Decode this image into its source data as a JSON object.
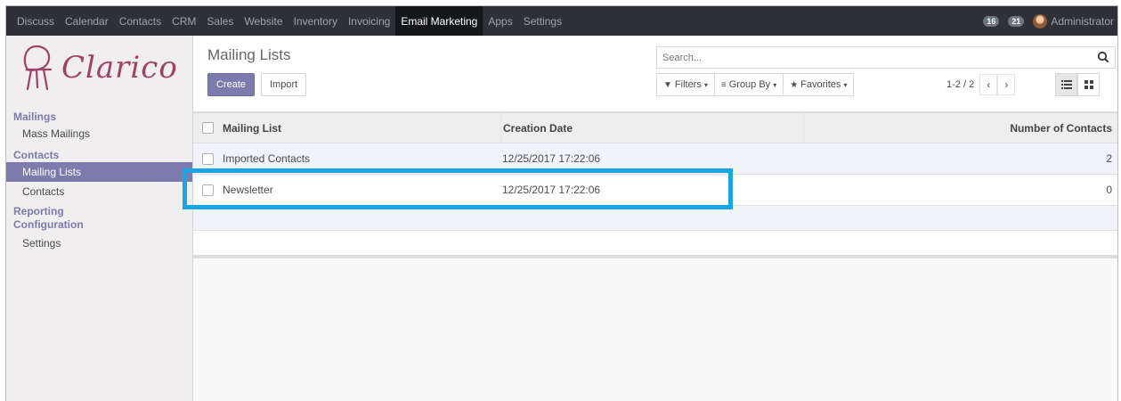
{
  "topbar": {
    "menu": [
      "Discuss",
      "Calendar",
      "Contacts",
      "CRM",
      "Sales",
      "Website",
      "Inventory",
      "Invoicing",
      "Email Marketing",
      "Apps",
      "Settings"
    ],
    "active": "Email Marketing",
    "badge1": "16",
    "badge2": "21",
    "user": "Administrator"
  },
  "sidebar": {
    "logo": "Clarico",
    "section_mailings": "Mailings",
    "mass_mailings": "Mass Mailings",
    "section_contacts": "Contacts",
    "mailing_lists": "Mailing Lists",
    "contacts": "Contacts",
    "section_reporting": "Reporting",
    "section_configuration": "Configuration",
    "settings": "Settings"
  },
  "control": {
    "title": "Mailing Lists",
    "create": "Create",
    "import": "Import",
    "search_placeholder": "Search...",
    "filters": "Filters",
    "group_by": "Group By",
    "favorites": "Favorites",
    "pager": "1-2 / 2"
  },
  "table": {
    "headers": {
      "name": "Mailing List",
      "date": "Creation Date",
      "count": "Number of Contacts"
    },
    "rows": [
      {
        "name": "Imported Contacts",
        "date": "12/25/2017 17:22:06",
        "count": "2"
      },
      {
        "name": "Newsletter",
        "date": "12/25/2017 17:22:06",
        "count": "0"
      }
    ]
  },
  "colors": {
    "accent": "#7c7bad",
    "navbar": "#2f3136",
    "highlight": "#17a6e6",
    "logo": "#a04168"
  }
}
